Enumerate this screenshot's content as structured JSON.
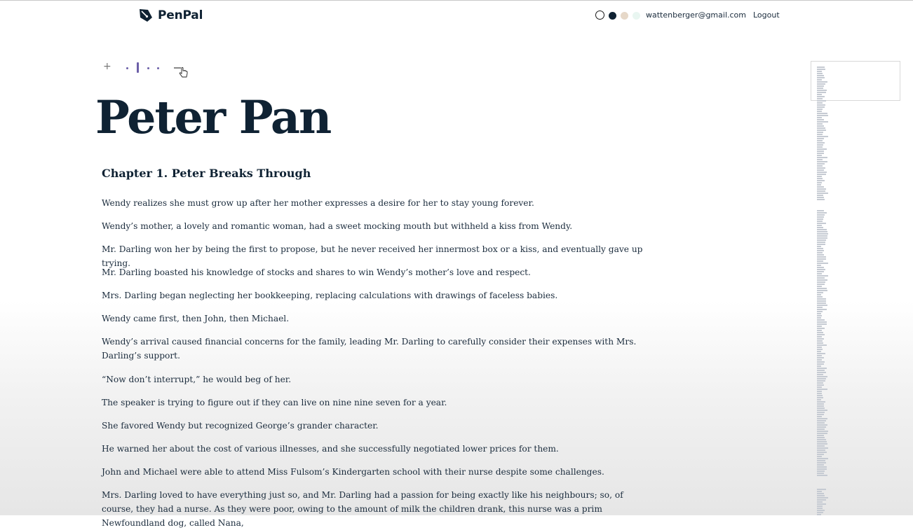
{
  "header": {
    "app_name": "PenPal",
    "logo_icon": "pen-nib-logo-icon",
    "theme_options": [
      "light",
      "dark",
      "sepia",
      "mint"
    ],
    "user_email": "wattenberger@gmail.com",
    "logout_label": "Logout"
  },
  "zoom_control": {
    "plus_symbol": "+",
    "minus_symbol": "–",
    "levels": 5,
    "active_level": 2
  },
  "book": {
    "title": "Peter Pan",
    "chapter_title": "Chapter 1. Peter Breaks Through",
    "paragraphs": [
      "Wendy realizes she must grow up after her mother expresses a desire for her to stay young forever.",
      "Wendy’s mother, a lovely and romantic woman, had a sweet mocking mouth but withheld a kiss from Wendy.",
      "Mr. Darling won her by being the first to propose, but he never received her innermost box or a kiss, and eventually gave up trying.",
      "Mr. Darling boasted his knowledge of stocks and shares to win Wendy’s mother’s love and respect.",
      "Mrs. Darling began neglecting her bookkeeping, replacing calculations with drawings of faceless babies.",
      "Wendy came first, then John, then Michael.",
      "Wendy’s arrival caused financial concerns for the family, leading Mr. Darling to carefully consider their expenses with Mrs. Darling’s support.",
      "“Now don’t interrupt,” he would beg of her.",
      "The speaker is trying to figure out if they can live on nine nine seven for a year.",
      "She favored Wendy but recognized George’s grander character.",
      "He warned her about the cost of various illnesses, and she successfully negotiated lower prices for them.",
      "John and Michael were able to attend Miss Fulsom’s Kindergarten school with their nurse despite some challenges.",
      "Mrs. Darling loved to have everything just so, and Mr. Darling had a passion for being exactly like his neighbours; so, of course, they had a nurse. As they were poor, owing to the amount of milk the children drank, this nurse was a prim Newfoundland dog, called Nana,"
    ]
  },
  "colors": {
    "title": "#0f2233",
    "text": "#1a2b3c",
    "accent": "#6c5fa8",
    "minimap": "#c5cad2"
  }
}
